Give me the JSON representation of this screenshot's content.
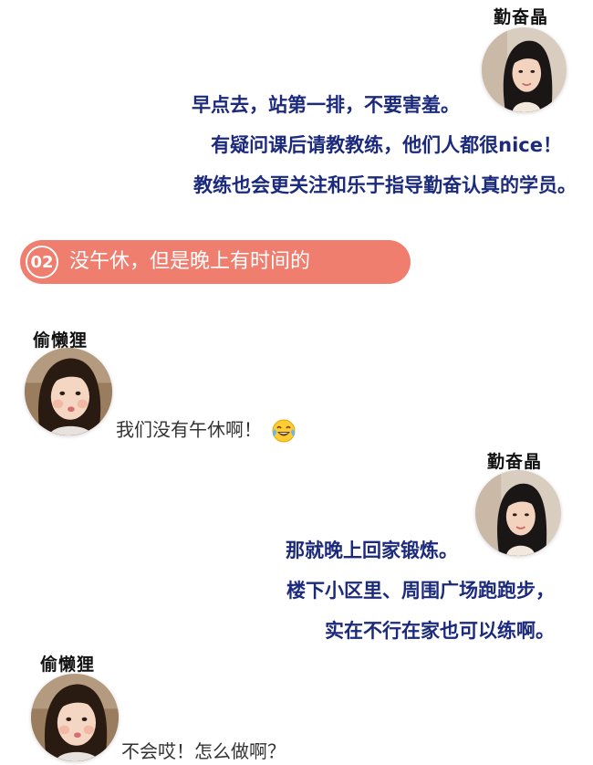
{
  "speaker_a": {
    "name": "勤奋晶",
    "avatar_icon": "avatar-portrait-woman-long-hair"
  },
  "speaker_b": {
    "name": "偷懒狸",
    "avatar_icon": "avatar-portrait-woman-puffed-cheeks"
  },
  "block1": {
    "lines": [
      "早点去，站第一排，不要害羞。",
      "有疑问课后请教教练，他们人都很nice！",
      "教练也会更关注和乐于指导勤奋认真的学员。"
    ]
  },
  "section": {
    "number": "02",
    "title": "没午休，但是晚上有时间的"
  },
  "chat1": {
    "text": "我们没有午休啊！",
    "emoji": "tears-of-joy-emoji"
  },
  "block2": {
    "lines": [
      "那就晚上回家锻炼。",
      "楼下小区里、周围广场跑跑步，",
      "实在不行在家也可以练啊。"
    ]
  },
  "chat2": {
    "text": "不会哎！怎么做啊？"
  },
  "colors": {
    "advice_text": "#1c2a7c",
    "pill": "#ef7e6f",
    "chat_text": "#333333"
  }
}
